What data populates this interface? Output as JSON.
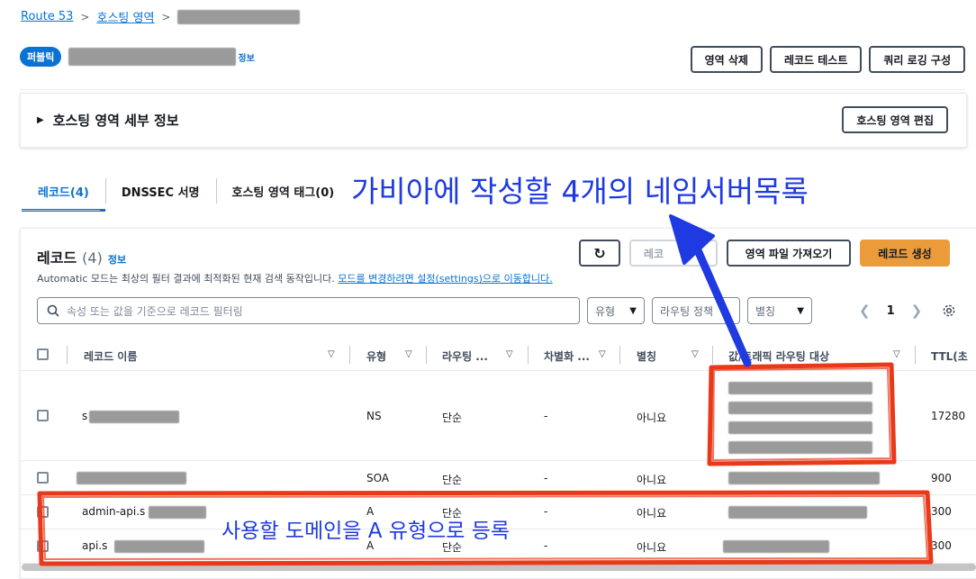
{
  "breadcrumb": {
    "root": "Route 53",
    "hosted_zones": "호스팅 영역"
  },
  "header": {
    "badge": "퍼블릭",
    "info_link": "정보",
    "actions": {
      "delete": "영역 삭제",
      "test": "레코드 테스트",
      "query_logging": "쿼리 로깅 구성"
    }
  },
  "details": {
    "title": "호스팅 영역 세부 정보",
    "edit": "호스팅 영역 편집"
  },
  "tabs": [
    {
      "label": "레코드(4)"
    },
    {
      "label": "DNSSEC 서명"
    },
    {
      "label": "호스팅 영역 태그(0)"
    }
  ],
  "records": {
    "title": "레코드",
    "count": "(4)",
    "info": "정보",
    "desc_prefix": "Automatic 모드는 최상의 필터 결과에 최적화된 현재 검색 동작입니다.",
    "desc_link": "모드를 변경하려면 설정(settings)으로 이동합니다.",
    "actions": {
      "delete_partial": "레코",
      "import": "영역 파일 가져오기",
      "create": "레코드 생성"
    },
    "search_placeholder": "속성 또는 값을 기준으로 레코드 필터링",
    "filters": {
      "type": "유형",
      "routing": "라우팅 정책",
      "alias": "별칭"
    },
    "page": "1"
  },
  "table": {
    "headers": {
      "name": "레코드 이름",
      "type": "유형",
      "routing": "라우팅 ...",
      "diff": "차별화 ...",
      "alias": "별칭",
      "value": "값/트래픽 라우팅 대상",
      "ttl": "TTL(초"
    },
    "rows": [
      {
        "name": "s",
        "type": "NS",
        "routing": "단순",
        "diff": "-",
        "alias": "아니요",
        "ttl": "17280"
      },
      {
        "name": "",
        "type": "SOA",
        "routing": "단순",
        "diff": "-",
        "alias": "아니요",
        "ttl": "900"
      },
      {
        "name": "admin-api.s",
        "type": "A",
        "routing": "단순",
        "diff": "-",
        "alias": "아니요",
        "ttl": "300"
      },
      {
        "name": "api.s",
        "type": "A",
        "routing": "단순",
        "diff": "-",
        "alias": "아니요",
        "ttl": "300"
      }
    ]
  },
  "annotations": {
    "nameserver_note": "가비아에 작성할 4개의 네임서버목록",
    "domain_note": "사용할 도메인을 A 유형으로 등록"
  },
  "colors": {
    "accent": "#0972d3",
    "primary_button": "#ec9b3b",
    "annotation_red": "#e8391a",
    "annotation_blue": "#1f3ae0"
  }
}
